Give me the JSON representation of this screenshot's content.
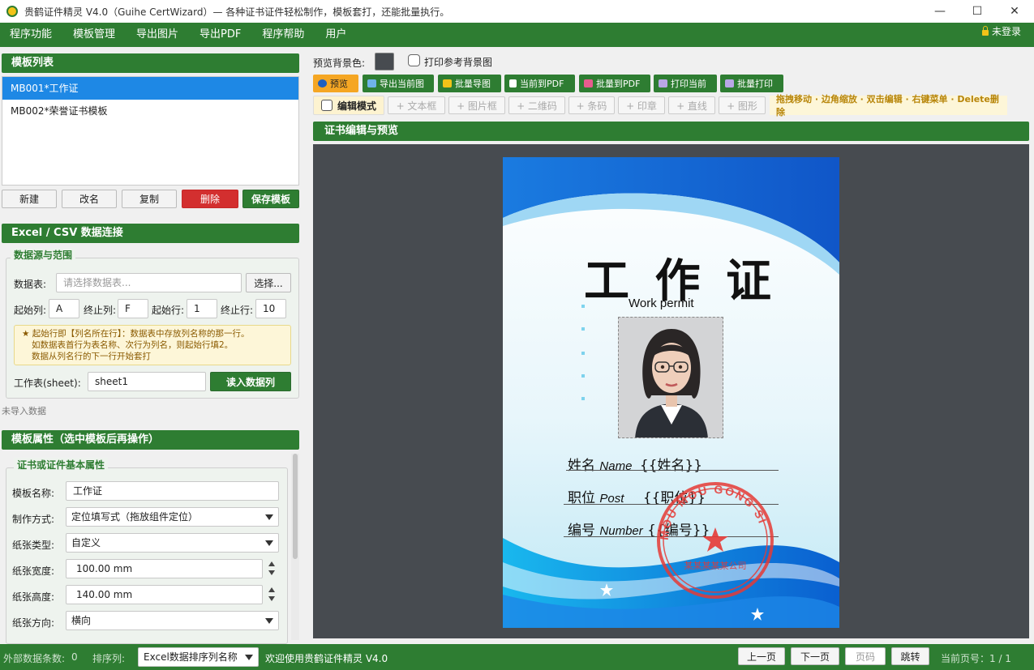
{
  "window": {
    "title": "贵鹤证件精灵 V4.0（Guihe CertWizard）— 各种证书证件轻松制作，模板套打，还能批量执行。"
  },
  "menu": {
    "items": [
      "程序功能",
      "模板管理",
      "导出图片",
      "导出PDF",
      "程序帮助",
      "用户"
    ],
    "login": "未登录"
  },
  "template_list": {
    "header": "模板列表",
    "items": [
      {
        "label": "MB001*工作证",
        "selected": true
      },
      {
        "label": "MB002*荣誉证书模板",
        "selected": false
      }
    ],
    "buttons": {
      "new": "新建",
      "rename": "改名",
      "copy": "复制",
      "delete": "删除",
      "save": "保存模板"
    }
  },
  "excel": {
    "header": "Excel / CSV 数据连接",
    "group_title": "数据源与范围",
    "table_label": "数据表:",
    "table_placeholder": "请选择数据表...",
    "choose_button": "选择...",
    "start_col_label": "起始列:",
    "start_col": "A",
    "end_col_label": "终止列:",
    "end_col": "F",
    "start_row_label": "起始行:",
    "start_row": "1",
    "end_row_label": "终止行:",
    "end_row": "10",
    "tip_lines": [
      "★ 起始行即【列名所在行】：数据表中存放列名称的那一行。",
      "如数据表首行为表名称、次行为列名，则起始行填2。",
      "数据从列名行的下一行开始套打"
    ],
    "sheet_label": "工作表(sheet):",
    "sheet_value": "sheet1",
    "read_button": "读入数据列",
    "status": "未导入数据"
  },
  "properties": {
    "header": "模板属性（选中模板后再操作）",
    "group_title": "证书或证件基本属性",
    "name_label": "模板名称:",
    "name_value": "工作证",
    "method_label": "制作方式:",
    "method_value": "定位填写式（拖放组件定位）",
    "paper_type_label": "纸张类型:",
    "paper_type_value": "自定义",
    "width_label": "纸张宽度:",
    "width_value": "100.00 mm",
    "height_label": "纸张高度:",
    "height_value": "140.00 mm",
    "orientation_label": "纸张方向:",
    "orientation_value": "横向"
  },
  "toolbar": {
    "bg_color_label": "预览背景色:",
    "print_bg_label": "打印参考背景图",
    "buttons": [
      "预览",
      "导出当前图",
      "批量导图",
      "当前到PDF",
      "批量到PDF",
      "打印当前",
      "批量打印"
    ],
    "edit_mode": "编辑模式",
    "components": [
      "+ 文本框",
      "+ 图片框",
      "+ 二维码",
      "+ 条码",
      "+ 印章",
      "+ 直线",
      "+ 图形"
    ],
    "hint": "拖拽移动 · 边角缩放 · 双击编辑 · 右键菜单 · Delete删除"
  },
  "editor": {
    "header": "证书编辑与预览"
  },
  "card": {
    "title": "工 作 证",
    "subtitle": "Work permit",
    "name_cn": "姓名",
    "name_en": "Name",
    "name_field": "{{姓名}}",
    "post_cn": "职位",
    "post_en": "Post",
    "post_field": "{{职位}}",
    "number_cn": "编号",
    "number_en": "Number",
    "number_field": "{{编号}}",
    "stamp_text": "MOU MOU GONG SI",
    "stamp_cn": "某某某某某公司"
  },
  "statusbar": {
    "count_label": "外部数据条数:",
    "count_value": "0",
    "sort_label": "排序列:",
    "sort_value": "Excel数据排序列名称",
    "welcome": "欢迎使用贵鹤证件精灵 V4.0",
    "prev": "上一页",
    "next": "下一页",
    "page_placeholder": "页码",
    "jump": "跳转",
    "current_page": "当前页号：1 / 1"
  },
  "colors": {
    "primary": "#2e7d32",
    "selected": "#1e88e5",
    "danger": "#d32f2f",
    "accent": "#f5a623",
    "preview_bg": "#474b50"
  }
}
